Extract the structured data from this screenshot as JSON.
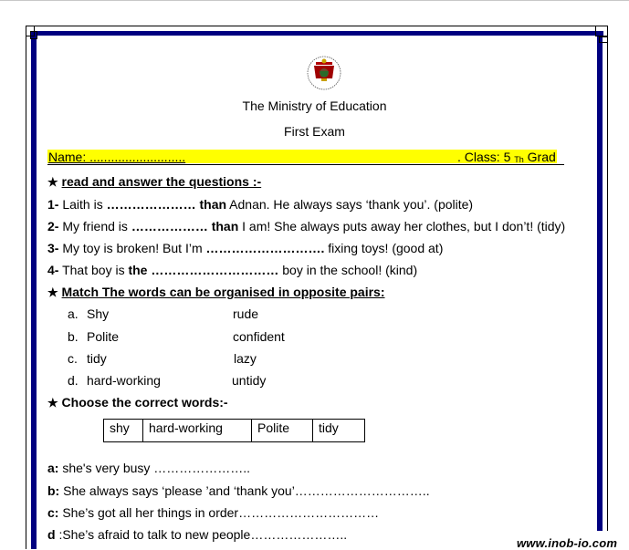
{
  "header": {
    "logo": "ministry-emblem",
    "ministry": "The Ministry of Education",
    "exam": "First Exam"
  },
  "namebar": {
    "name_label": "Name: ...........................",
    "class_label": ". Class: 5 ",
    "class_sup": "Th",
    "class_suffix": " Grad",
    "highlight_color": "#ffff00"
  },
  "section1": {
    "icon": "star",
    "title": "read and answer the questions :-",
    "items": [
      {
        "num": "1-",
        "pre": " Laith is ",
        "blank": "…………………",
        "bold": " than",
        "post": " Adnan. He always says ‘thank you’. (polite)"
      },
      {
        "num": "2-",
        "pre": " My friend is ",
        "blank": "………………",
        "bold": " than",
        "post": " I am! She always puts away her   clothes, but I don’t! (tidy)"
      },
      {
        "num": "3-",
        "pre": " My toy is broken! But I’m ",
        "blank": "……………………….",
        "bold": "",
        "post": " fixing toys! (good at)"
      },
      {
        "num": "4-",
        "pre": " That boy is ",
        "blank": "…………………………",
        "bold": "the",
        "post": " boy in the school! (kind)"
      }
    ]
  },
  "section2": {
    "icon": "star",
    "title": "Match The words can be organised in opposite pairs:",
    "pairs": [
      {
        "letter": "a.",
        "left": "Shy",
        "right": "rude"
      },
      {
        "letter": "b.",
        "left": "Polite",
        "right": "confident"
      },
      {
        "letter": "c.",
        "left": "tidy",
        "right": "lazy"
      },
      {
        "letter": "d.",
        "left": "hard-working",
        "right": "untidy"
      }
    ]
  },
  "section3": {
    "icon": "star",
    "title": "Choose the correct words:-",
    "word_bank": [
      "shy",
      "hard-working",
      "Polite",
      "tidy"
    ],
    "items": [
      {
        "label": "a:",
        "text": " she's very busy ………………….."
      },
      {
        "label": "b:",
        "text": " She always says ‘please ’and ‘thank you’………………………….."
      },
      {
        "label": "c:",
        "text": " She’s got all her things in order……………………………"
      },
      {
        "label": "d",
        "text": " :She’s afraid to talk to new people………………….."
      }
    ]
  },
  "watermark": "www.inob-io.com",
  "colors": {
    "border": "#000080",
    "highlight": "#ffff00"
  }
}
